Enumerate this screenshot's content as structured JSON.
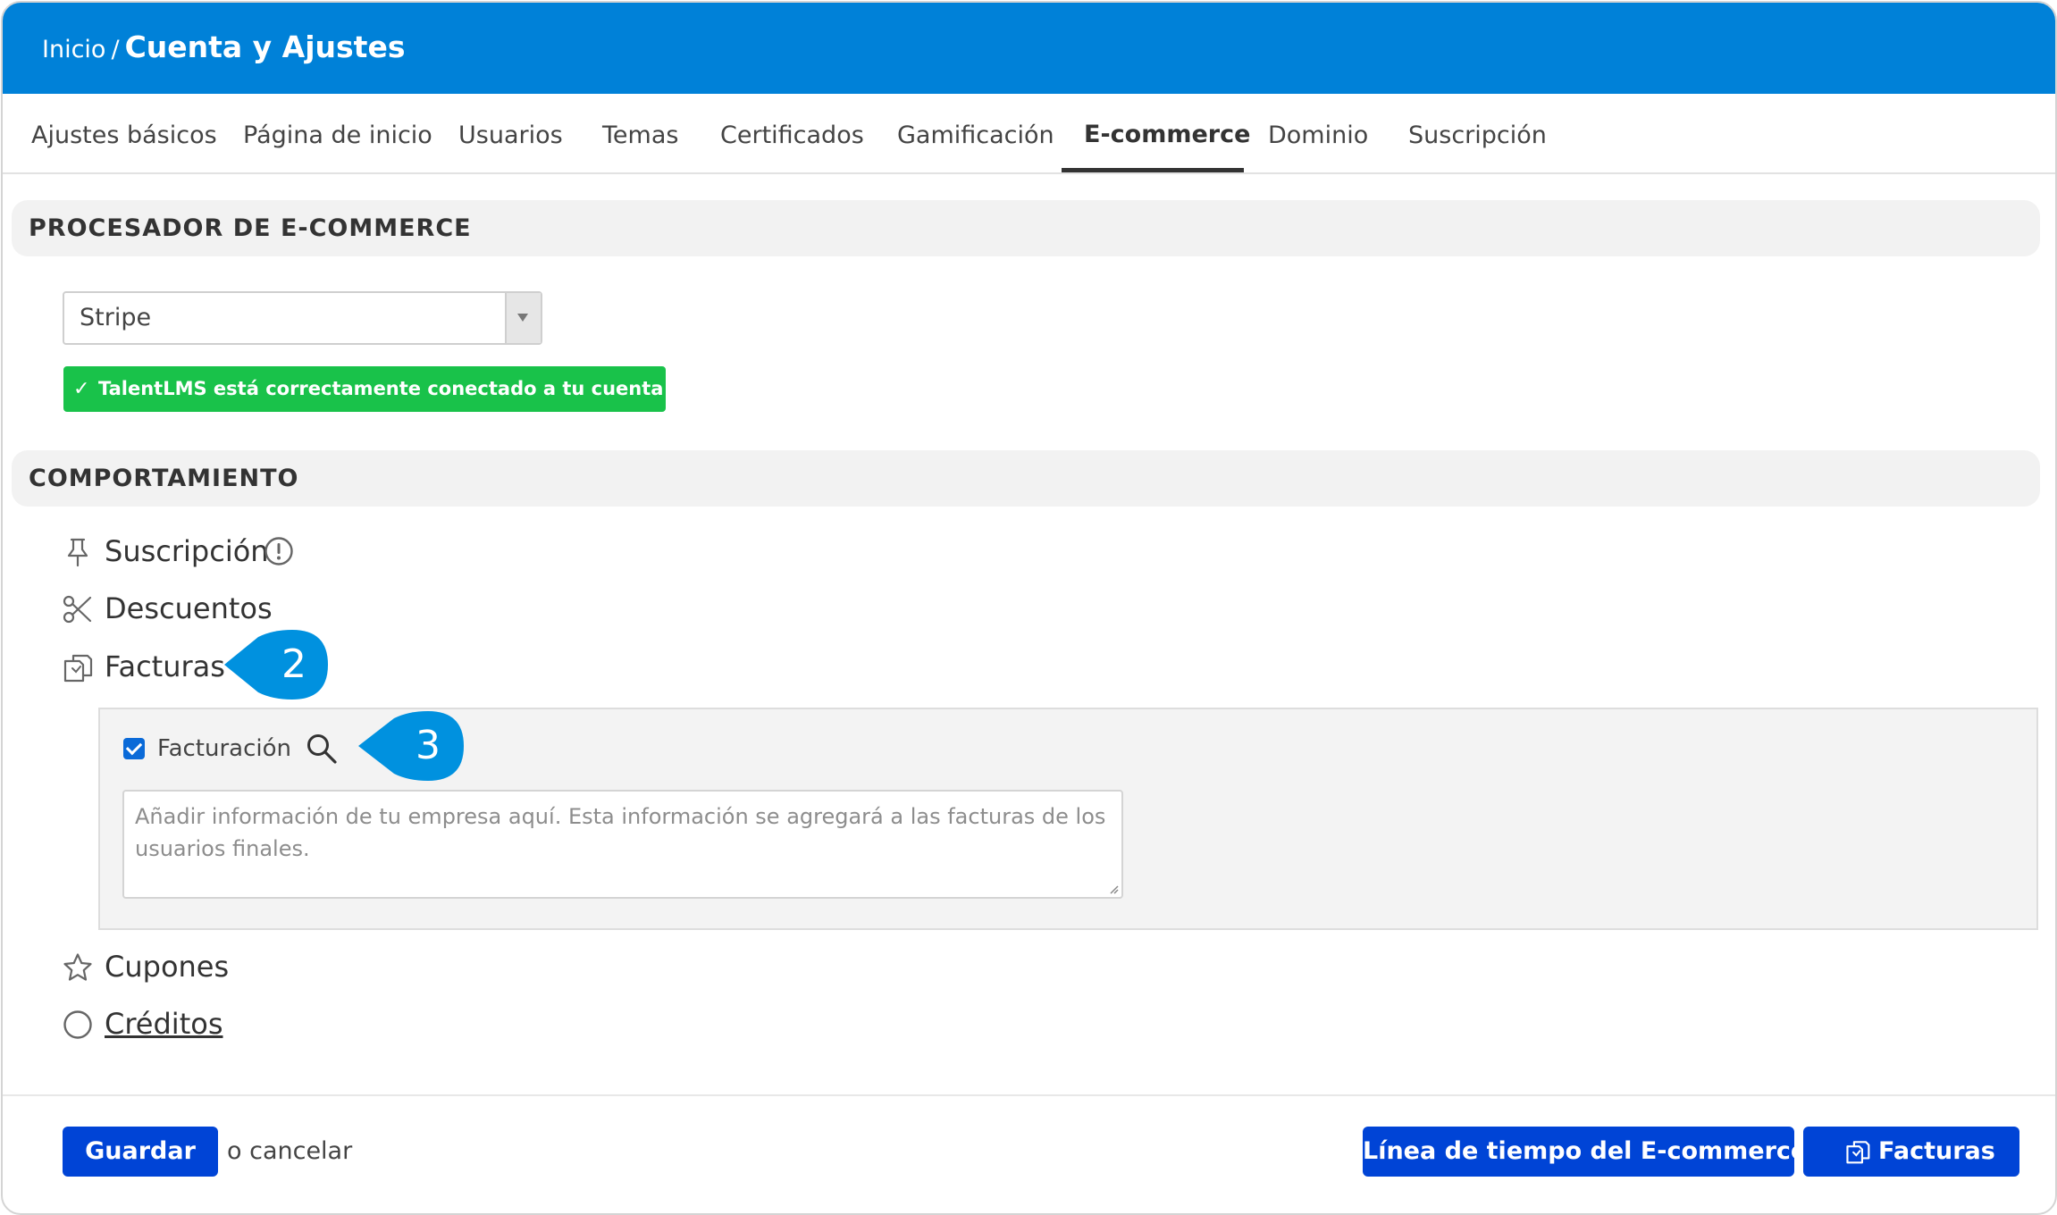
{
  "header": {
    "breadcrumb_home": "Inicio",
    "breadcrumb_separator": "/",
    "title": "Cuenta y Ajustes"
  },
  "tabs": [
    {
      "label": "Ajustes básicos",
      "active": false
    },
    {
      "label": "Página de inicio",
      "active": false
    },
    {
      "label": "Usuarios",
      "active": false
    },
    {
      "label": "Temas",
      "active": false
    },
    {
      "label": "Certificados",
      "active": false
    },
    {
      "label": "Gamificación",
      "active": false
    },
    {
      "label": "E-commerce",
      "active": true
    },
    {
      "label": "Dominio",
      "active": false
    },
    {
      "label": "Suscripción",
      "active": false
    }
  ],
  "processor": {
    "section_title": "PROCESADOR DE E-COMMERCE",
    "select_value": "Stripe",
    "status_message": "TalentLMS está correctamente conectado a tu cuenta Stripe"
  },
  "behavior": {
    "section_title": "COMPORTAMIENTO",
    "features": [
      {
        "label": "Suscripción",
        "icon": "pin-icon"
      },
      {
        "label": "Descuentos",
        "icon": "scissors-icon"
      },
      {
        "label": "Facturas",
        "icon": "invoices-icon"
      },
      {
        "label": "Cupones",
        "icon": "star-icon"
      },
      {
        "label": "Créditos",
        "icon": "circle-icon"
      }
    ],
    "invoice_panel": {
      "checkbox_label": "Facturación",
      "checked": true,
      "textarea_placeholder": "Añadir información de tu empresa aquí. Esta información se agregará a las facturas de los usuarios finales."
    }
  },
  "callouts": {
    "first": "2",
    "second": "3"
  },
  "footer": {
    "save_label": "Guardar",
    "cancel_label": "o cancelar",
    "timeline_label": "Línea de tiempo del E-commerce",
    "invoices_label": "Facturas"
  },
  "colors": {
    "header": "#0081d8",
    "primary_button": "#0044d6",
    "success": "#19c24a",
    "callout": "#0091df"
  }
}
